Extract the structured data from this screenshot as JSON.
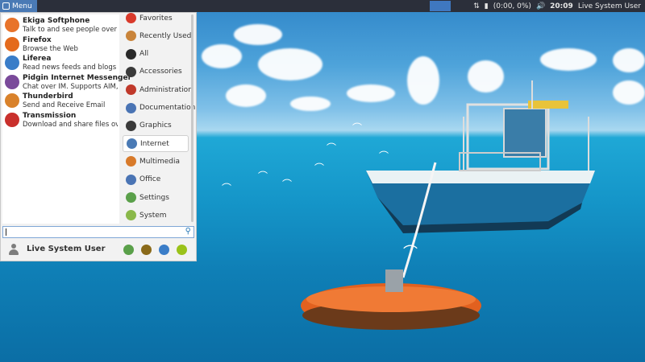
{
  "panel": {
    "menu_label": "Menu",
    "clock": "20:09",
    "battery": "(0:00, 0%)",
    "user": "Live System User"
  },
  "favorites": [
    {
      "title": "Ekiga Softphone",
      "desc": "Talk to and see people over t...",
      "icon": "ekiga-icon",
      "color": "#e8732a"
    },
    {
      "title": "Firefox",
      "desc": "Browse the Web",
      "icon": "firefox-icon",
      "color": "#e46a1c"
    },
    {
      "title": "Liferea",
      "desc": "Read news feeds and blogs",
      "icon": "liferea-icon",
      "color": "#3a7dc8"
    },
    {
      "title": "Pidgin Internet Messenger",
      "desc": "Chat over IM.  Supports AIM, ...",
      "icon": "pidgin-icon",
      "color": "#7a4a9a"
    },
    {
      "title": "Thunderbird",
      "desc": "Send and Receive Email",
      "icon": "thunderbird-icon",
      "color": "#d9822b"
    },
    {
      "title": "Transmission",
      "desc": "Download and share files ov...",
      "icon": "transmission-icon",
      "color": "#c9302c"
    }
  ],
  "categories": [
    {
      "label": "Favorites",
      "icon": "bookmark-icon",
      "color": "#d93a2b"
    },
    {
      "label": "Recently Used",
      "icon": "clock-icon",
      "color": "#c9843a"
    },
    {
      "label": "All",
      "icon": "all-apps-icon",
      "color": "#2a2a2a"
    },
    {
      "label": "Accessories",
      "icon": "accessories-icon",
      "color": "#3a3a3a"
    },
    {
      "label": "Administration",
      "icon": "administration-icon",
      "color": "#c0392b"
    },
    {
      "label": "Documentation",
      "icon": "documentation-icon",
      "color": "#4a74b4"
    },
    {
      "label": "Graphics",
      "icon": "graphics-icon",
      "color": "#3a3a3a"
    },
    {
      "label": "Internet",
      "icon": "internet-icon",
      "color": "#4a7ab5"
    },
    {
      "label": "Multimedia",
      "icon": "multimedia-icon",
      "color": "#d87a2a"
    },
    {
      "label": "Office",
      "icon": "office-icon",
      "color": "#4a74b4"
    },
    {
      "label": "Settings",
      "icon": "settings-icon",
      "color": "#5aa04a"
    },
    {
      "label": "System",
      "icon": "system-icon",
      "color": "#8ab84a"
    }
  ],
  "active_category": "Internet",
  "user": {
    "name": "Live System User",
    "buttons": [
      {
        "name": "settings-manager-icon",
        "color": "#5aa04a"
      },
      {
        "name": "lock-screen-icon",
        "color": "#8a6a1a"
      },
      {
        "name": "switch-user-icon",
        "color": "#3a7dc8"
      },
      {
        "name": "logout-icon",
        "color": "#9ac21a"
      }
    ]
  }
}
